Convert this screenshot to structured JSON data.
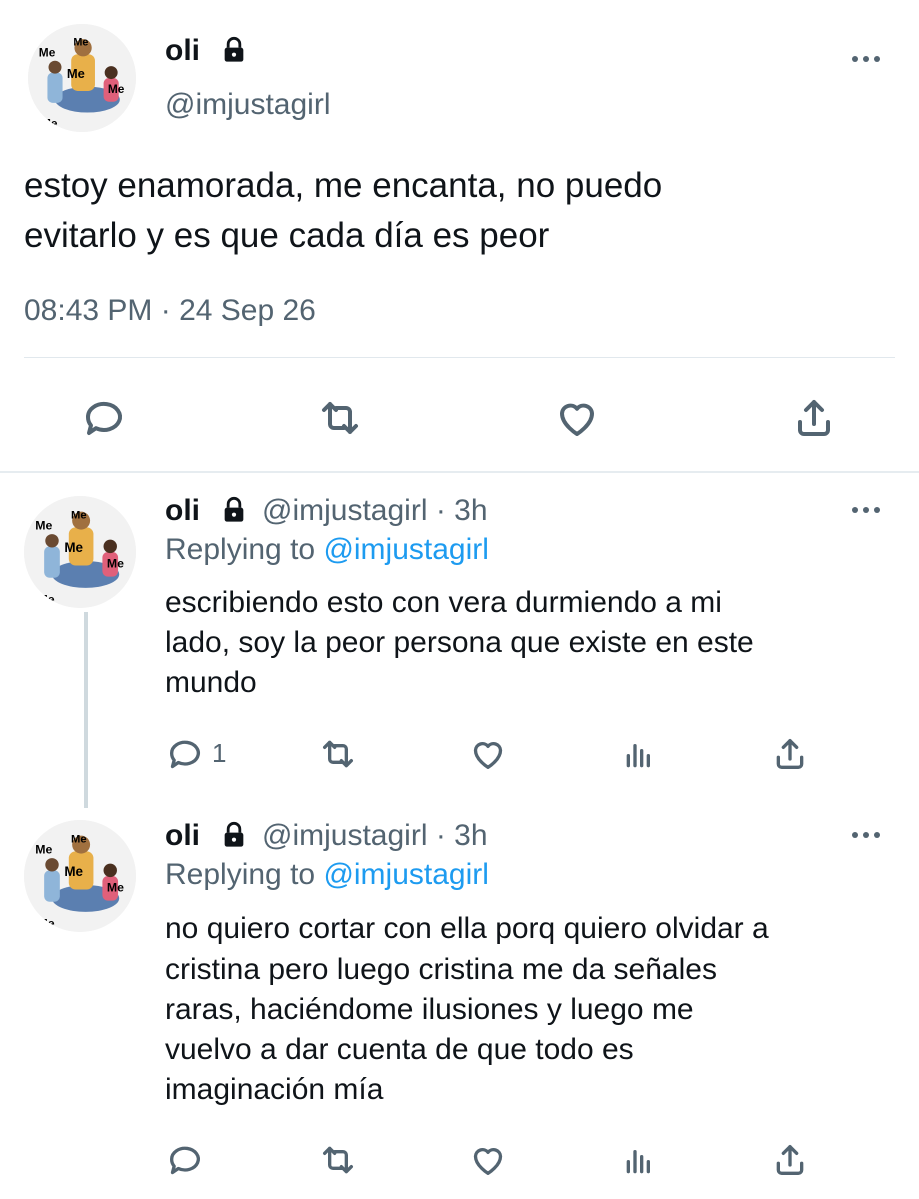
{
  "main_tweet": {
    "display_name": "oli",
    "handle": "@imjustagirl",
    "text_line1": "estoy enamorada, me encanta, no puedo",
    "text_line2": "evitarlo y es que cada día es peor",
    "timestamp": "08:43 PM · 24 Sep 26"
  },
  "avatar_labels": [
    "Me",
    "Me",
    "Me",
    "Me",
    "Me"
  ],
  "replies": [
    {
      "display_name": "oli",
      "meta": "@imjustagirl · 3h",
      "replying_prefix": "Replying to",
      "replying_handle": "@imjustagirl",
      "lines": [
        "escribiendo esto con vera durmiendo a mi",
        "lado, soy la peor persona que existe en este",
        "mundo"
      ],
      "reply_count": "1"
    },
    {
      "display_name": "oli",
      "meta": "@imjustagirl · 3h",
      "replying_prefix": "Replying to",
      "replying_handle": "@imjustagirl",
      "lines": [
        "no quiero cortar con ella porq quiero olvidar a",
        "cristina pero luego cristina me da señales",
        "raras, haciéndome ilusiones y luego me",
        "vuelvo a dar cuenta de que todo es",
        "imaginación mía"
      ],
      "reply_count": ""
    }
  ],
  "icons": {
    "reply": "comment-icon",
    "retweet": "retweet-icon",
    "like": "heart-icon",
    "share": "share-icon",
    "analytics": "analytics-icon",
    "lock": "lock-icon",
    "more": "more-icon"
  },
  "colors": {
    "text": "#0f1419",
    "muted": "#536471",
    "link": "#1d9bf0",
    "divider": "#e1e8ed",
    "thread_line": "#cfd9de"
  }
}
